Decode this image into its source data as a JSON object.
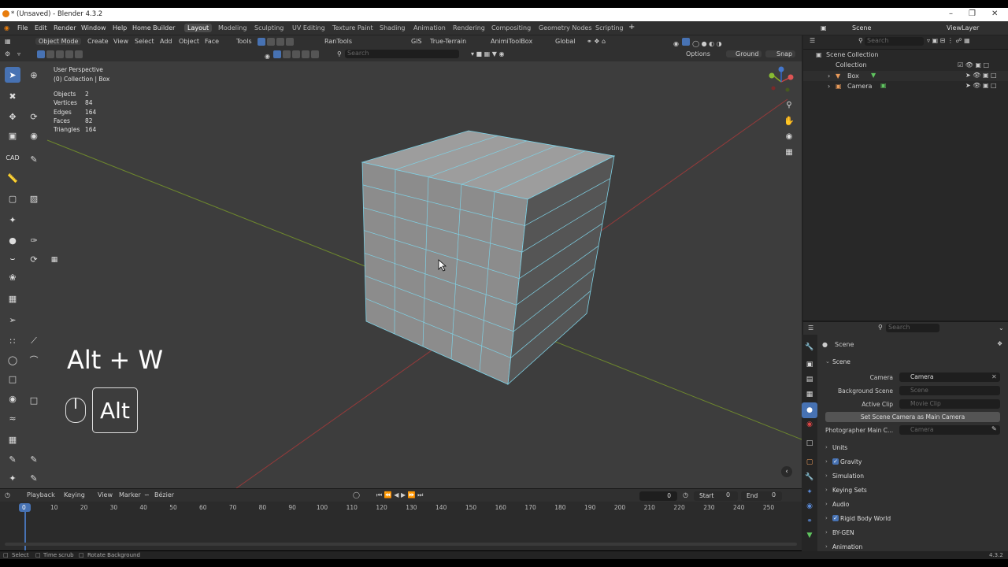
{
  "window": {
    "title": "* (Unsaved) - Blender 4.3.2"
  },
  "menu": {
    "items": [
      "File",
      "Edit",
      "Render",
      "Window",
      "Help",
      "Home Builder"
    ],
    "workspaces": [
      "Layout",
      "Modeling",
      "Sculpting",
      "UV Editing",
      "Texture Paint",
      "Shading",
      "Animation",
      "Rendering",
      "Compositing",
      "Geometry Nodes",
      "Scripting"
    ],
    "active_workspace": "Layout",
    "add_tab": "+",
    "scene": "Scene",
    "view_layer": "ViewLayer"
  },
  "header": {
    "mode": "Object Mode",
    "items": [
      "Create",
      "View",
      "Select",
      "Add",
      "Object",
      "Face",
      "Tools"
    ],
    "addons": [
      "RanTools",
      "GIS",
      "True-Terrain",
      "AnimiToolBox"
    ],
    "orientation": "Global",
    "options": "Options",
    "ground": "Ground",
    "snap": "Snap",
    "search_placeholder": "Search"
  },
  "viewport": {
    "view_name": "User Perspective",
    "collection": "(0) Collection | Box",
    "stats": [
      {
        "label": "Objects",
        "value": "2"
      },
      {
        "label": "Vertices",
        "value": "84"
      },
      {
        "label": "Edges",
        "value": "164"
      },
      {
        "label": "Faces",
        "value": "82"
      },
      {
        "label": "Triangles",
        "value": "164"
      }
    ],
    "shortcut_hint": "Alt + W",
    "key_label": "Alt",
    "cad_label": "CAD"
  },
  "outliner": {
    "search_placeholder": "Search",
    "root": "Scene Collection",
    "collection": "Collection",
    "objects": [
      "Box",
      "Camera"
    ]
  },
  "properties": {
    "search_placeholder": "Search",
    "breadcrumb": "Scene",
    "panel": "Scene",
    "camera_label": "Camera",
    "camera_value": "Camera",
    "bg_scene_label": "Background Scene",
    "bg_scene_placeholder": "Scene",
    "active_clip_label": "Active Clip",
    "active_clip_placeholder": "Movie Clip",
    "set_camera_button": "Set Scene Camera as Main Camera",
    "photographer_label": "Photographer Main C...",
    "photographer_placeholder": "Camera",
    "sections": [
      "Units",
      "Gravity",
      "Simulation",
      "Keying Sets",
      "Audio",
      "Rigid Body World",
      "BY-GEN",
      "Animation"
    ]
  },
  "timeline": {
    "menus": [
      "Playback",
      "Keying",
      "View",
      "Marker"
    ],
    "interpolation": "Bézier",
    "current_frame": "0",
    "start_label": "Start",
    "start_value": "0",
    "end_label": "End",
    "end_value": "0",
    "ticks": [
      "0",
      "10",
      "20",
      "30",
      "40",
      "50",
      "60",
      "70",
      "80",
      "90",
      "100",
      "110",
      "120",
      "130",
      "140",
      "150",
      "160",
      "170",
      "180",
      "190",
      "200",
      "210",
      "220",
      "230",
      "240",
      "250"
    ]
  },
  "statusbar": {
    "select": "Select",
    "time_scrub": "Time scrub",
    "rotate": "Rotate Background",
    "version": "4.3.2"
  },
  "colors": {
    "accent": "#4772b3",
    "viewport_bg": "#3d3d3d",
    "cube_face": "#8e8e8e",
    "wire": "#7fd2e6"
  }
}
